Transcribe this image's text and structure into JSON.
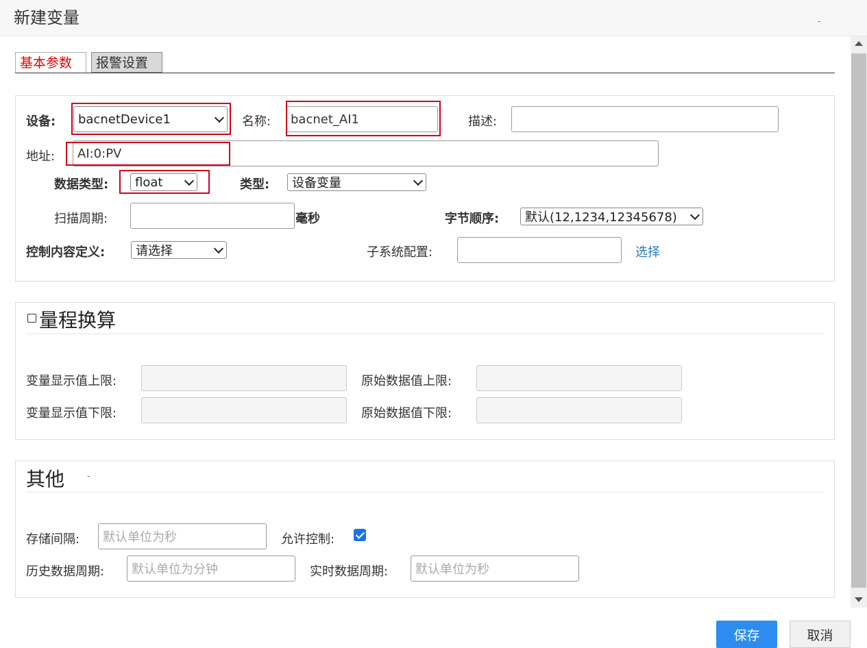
{
  "dialog": {
    "title": "新建变量",
    "min_glyph": "-"
  },
  "tabs": [
    {
      "label": "基本参数",
      "active": true
    },
    {
      "label": "报警设置",
      "active": false
    }
  ],
  "basic": {
    "device_label": "设备:",
    "device_value": "bacnetDevice1",
    "name_label": "名称:",
    "name_value": "bacnet_AI1",
    "desc_label": "描述:",
    "desc_value": "",
    "address_label": "地址:",
    "address_value": "AI:0:PV",
    "datatype_label": "数据类型:",
    "datatype_value": "float",
    "type_label": "类型:",
    "type_value": "设备变量",
    "scan_label": "扫描周期:",
    "scan_value": "",
    "scan_unit": "毫秒",
    "byteorder_label": "字节顺序:",
    "byteorder_value": "默认(12,1234,12345678)",
    "control_label": "控制内容定义:",
    "control_value": "请选择",
    "subsystem_label": "子系统配置:",
    "subsystem_value": "",
    "subsystem_link": "选择"
  },
  "range": {
    "title": "量程换算",
    "checked": false,
    "disp_upper_label": "变量显示值上限:",
    "raw_upper_label": "原始数据值上限:",
    "disp_lower_label": "变量显示值下限:",
    "raw_lower_label": "原始数据值下限:"
  },
  "other": {
    "title": "其他",
    "title_dash": "-",
    "storage_label": "存储间隔:",
    "storage_placeholder": "默认单位为秒",
    "allow_control_label": "允许控制:",
    "allow_control_checked": true,
    "history_label": "历史数据周期:",
    "history_placeholder": "默认单位为分钟",
    "realtime_label": "实时数据周期:",
    "realtime_placeholder": "默认单位为秒"
  },
  "buttons": {
    "save": "保存",
    "cancel": "取消"
  },
  "colors": {
    "highlight_box": "#d0021b",
    "active_tab_text": "#e00000",
    "save_button": "#2d8cf0",
    "link": "#2a7ab8",
    "checkbox": "#1a73e8"
  }
}
